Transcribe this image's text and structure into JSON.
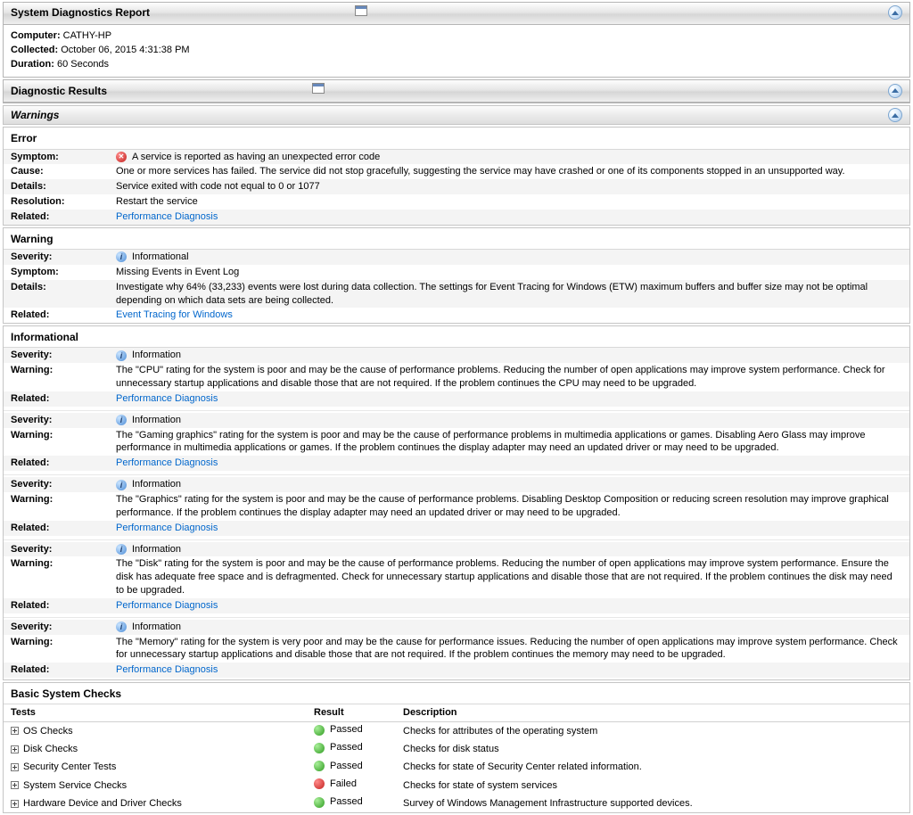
{
  "report": {
    "title": "System Diagnostics Report",
    "meta": {
      "computer_label": "Computer:",
      "computer": "CATHY-HP",
      "collected_label": "Collected:",
      "collected": "October 06, 2015 4:31:38 PM",
      "duration_label": "Duration:",
      "duration": "60 Seconds"
    }
  },
  "results_title": "Diagnostic Results",
  "warnings_title": "Warnings",
  "error": {
    "title": "Error",
    "rows": {
      "symptom_label": "Symptom:",
      "symptom": "A service is reported as having an unexpected error code",
      "cause_label": "Cause:",
      "cause": "One or more services has failed. The service did not stop gracefully, suggesting the service may have crashed or one of its components stopped in an unsupported way.",
      "details_label": "Details:",
      "details": "Service exited with code not equal to 0 or 1077",
      "resolution_label": "Resolution:",
      "resolution": "Restart the service",
      "related_label": "Related:",
      "related": "Performance Diagnosis"
    }
  },
  "warning": {
    "title": "Warning",
    "rows": {
      "severity_label": "Severity:",
      "severity": "Informational",
      "symptom_label": "Symptom:",
      "symptom": "Missing Events in Event Log",
      "details_label": "Details:",
      "details": "Investigate why 64% (33,233) events were lost during data collection. The settings for Event Tracing for Windows (ETW) maximum buffers and buffer size may not be optimal depending on which data sets are being collected.",
      "related_label": "Related:",
      "related": "Event Tracing for Windows"
    }
  },
  "informational": {
    "title": "Informational",
    "labels": {
      "severity": "Severity:",
      "warning": "Warning:",
      "related": "Related:",
      "severity_text": "Information",
      "related_link": "Performance Diagnosis"
    },
    "items": [
      "The \"CPU\" rating for the system is poor and may be the cause of performance problems. Reducing the number of open applications may improve system performance. Check for unnecessary startup applications and disable those that are not required. If the problem continues the CPU may need to be upgraded.",
      "The \"Gaming graphics\" rating for the system is poor and may be the cause of performance problems in multimedia applications or games. Disabling Aero Glass may improve performance in multimedia applications or games. If the problem continues the display adapter may need an updated driver or may need to be upgraded.",
      "The \"Graphics\" rating for the system is poor and may be the cause of performance problems. Disabling Desktop Composition or reducing screen resolution may improve graphical performance. If the problem continues the display adapter may need an updated driver or may need to be upgraded.",
      "The \"Disk\" rating for the system is poor and may be the cause of performance problems. Reducing the number of open applications may improve system performance. Ensure the disk has adequate free space and is defragmented. Check for unnecessary startup applications and disable those that are not required. If the problem continues the disk may need to be upgraded.",
      "The \"Memory\" rating for the system is very poor and may be the cause for performance issues. Reducing the number of open applications may improve system performance. Check for unnecessary startup applications and disable those that are not required. If the problem continues the memory may need to be upgraded."
    ]
  },
  "checks": {
    "title": "Basic System Checks",
    "headers": {
      "tests": "Tests",
      "result": "Result",
      "description": "Description"
    },
    "rows": [
      {
        "test": "OS Checks",
        "result": "Passed",
        "pass": true,
        "desc": "Checks for attributes of the operating system"
      },
      {
        "test": "Disk Checks",
        "result": "Passed",
        "pass": true,
        "desc": "Checks for disk status"
      },
      {
        "test": "Security Center Tests",
        "result": "Passed",
        "pass": true,
        "desc": "Checks for state of Security Center related information."
      },
      {
        "test": "System Service Checks",
        "result": "Failed",
        "pass": false,
        "desc": "Checks for state of system services"
      },
      {
        "test": "Hardware Device and Driver Checks",
        "result": "Passed",
        "pass": true,
        "desc": "Survey of Windows Management Infrastructure supported devices."
      }
    ]
  }
}
